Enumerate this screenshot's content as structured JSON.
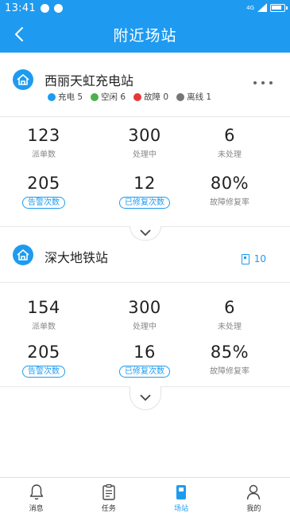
{
  "status_bar": {
    "time": "13:41",
    "network": "4G"
  },
  "header": {
    "title": "附近场站"
  },
  "stations": [
    {
      "name": "西丽天虹充电站",
      "tags": [
        {
          "label": "充电 5",
          "color": "#1e9bf0"
        },
        {
          "label": "空闲 6",
          "color": "#4caf50"
        },
        {
          "label": "故障 0",
          "color": "#e53935"
        },
        {
          "label": "离线 1",
          "color": "#757575"
        }
      ],
      "stats": [
        {
          "value": "123",
          "label": "派单数"
        },
        {
          "value": "300",
          "label": "处理中"
        },
        {
          "value": "6",
          "label": "未处理"
        },
        {
          "value": "205",
          "label": "告警次数"
        },
        {
          "value": "12",
          "label": "已修复次数"
        },
        {
          "value": "80%",
          "label": "故障修复率"
        }
      ]
    },
    {
      "name": "深大地铁站",
      "pile_count": "10",
      "stats": [
        {
          "value": "154",
          "label": "派单数"
        },
        {
          "value": "300",
          "label": "处理中"
        },
        {
          "value": "6",
          "label": "未处理"
        },
        {
          "value": "205",
          "label": "告警次数"
        },
        {
          "value": "16",
          "label": "已修复次数"
        },
        {
          "value": "85%",
          "label": "故障修复率"
        }
      ]
    }
  ],
  "tabbar": [
    {
      "label": "消息",
      "icon": "bell-icon"
    },
    {
      "label": "任务",
      "icon": "clipboard-icon"
    },
    {
      "label": "场站",
      "icon": "station-icon",
      "active": true
    },
    {
      "label": "我的",
      "icon": "user-icon"
    }
  ],
  "colors": {
    "primary": "#1e9bf0"
  }
}
